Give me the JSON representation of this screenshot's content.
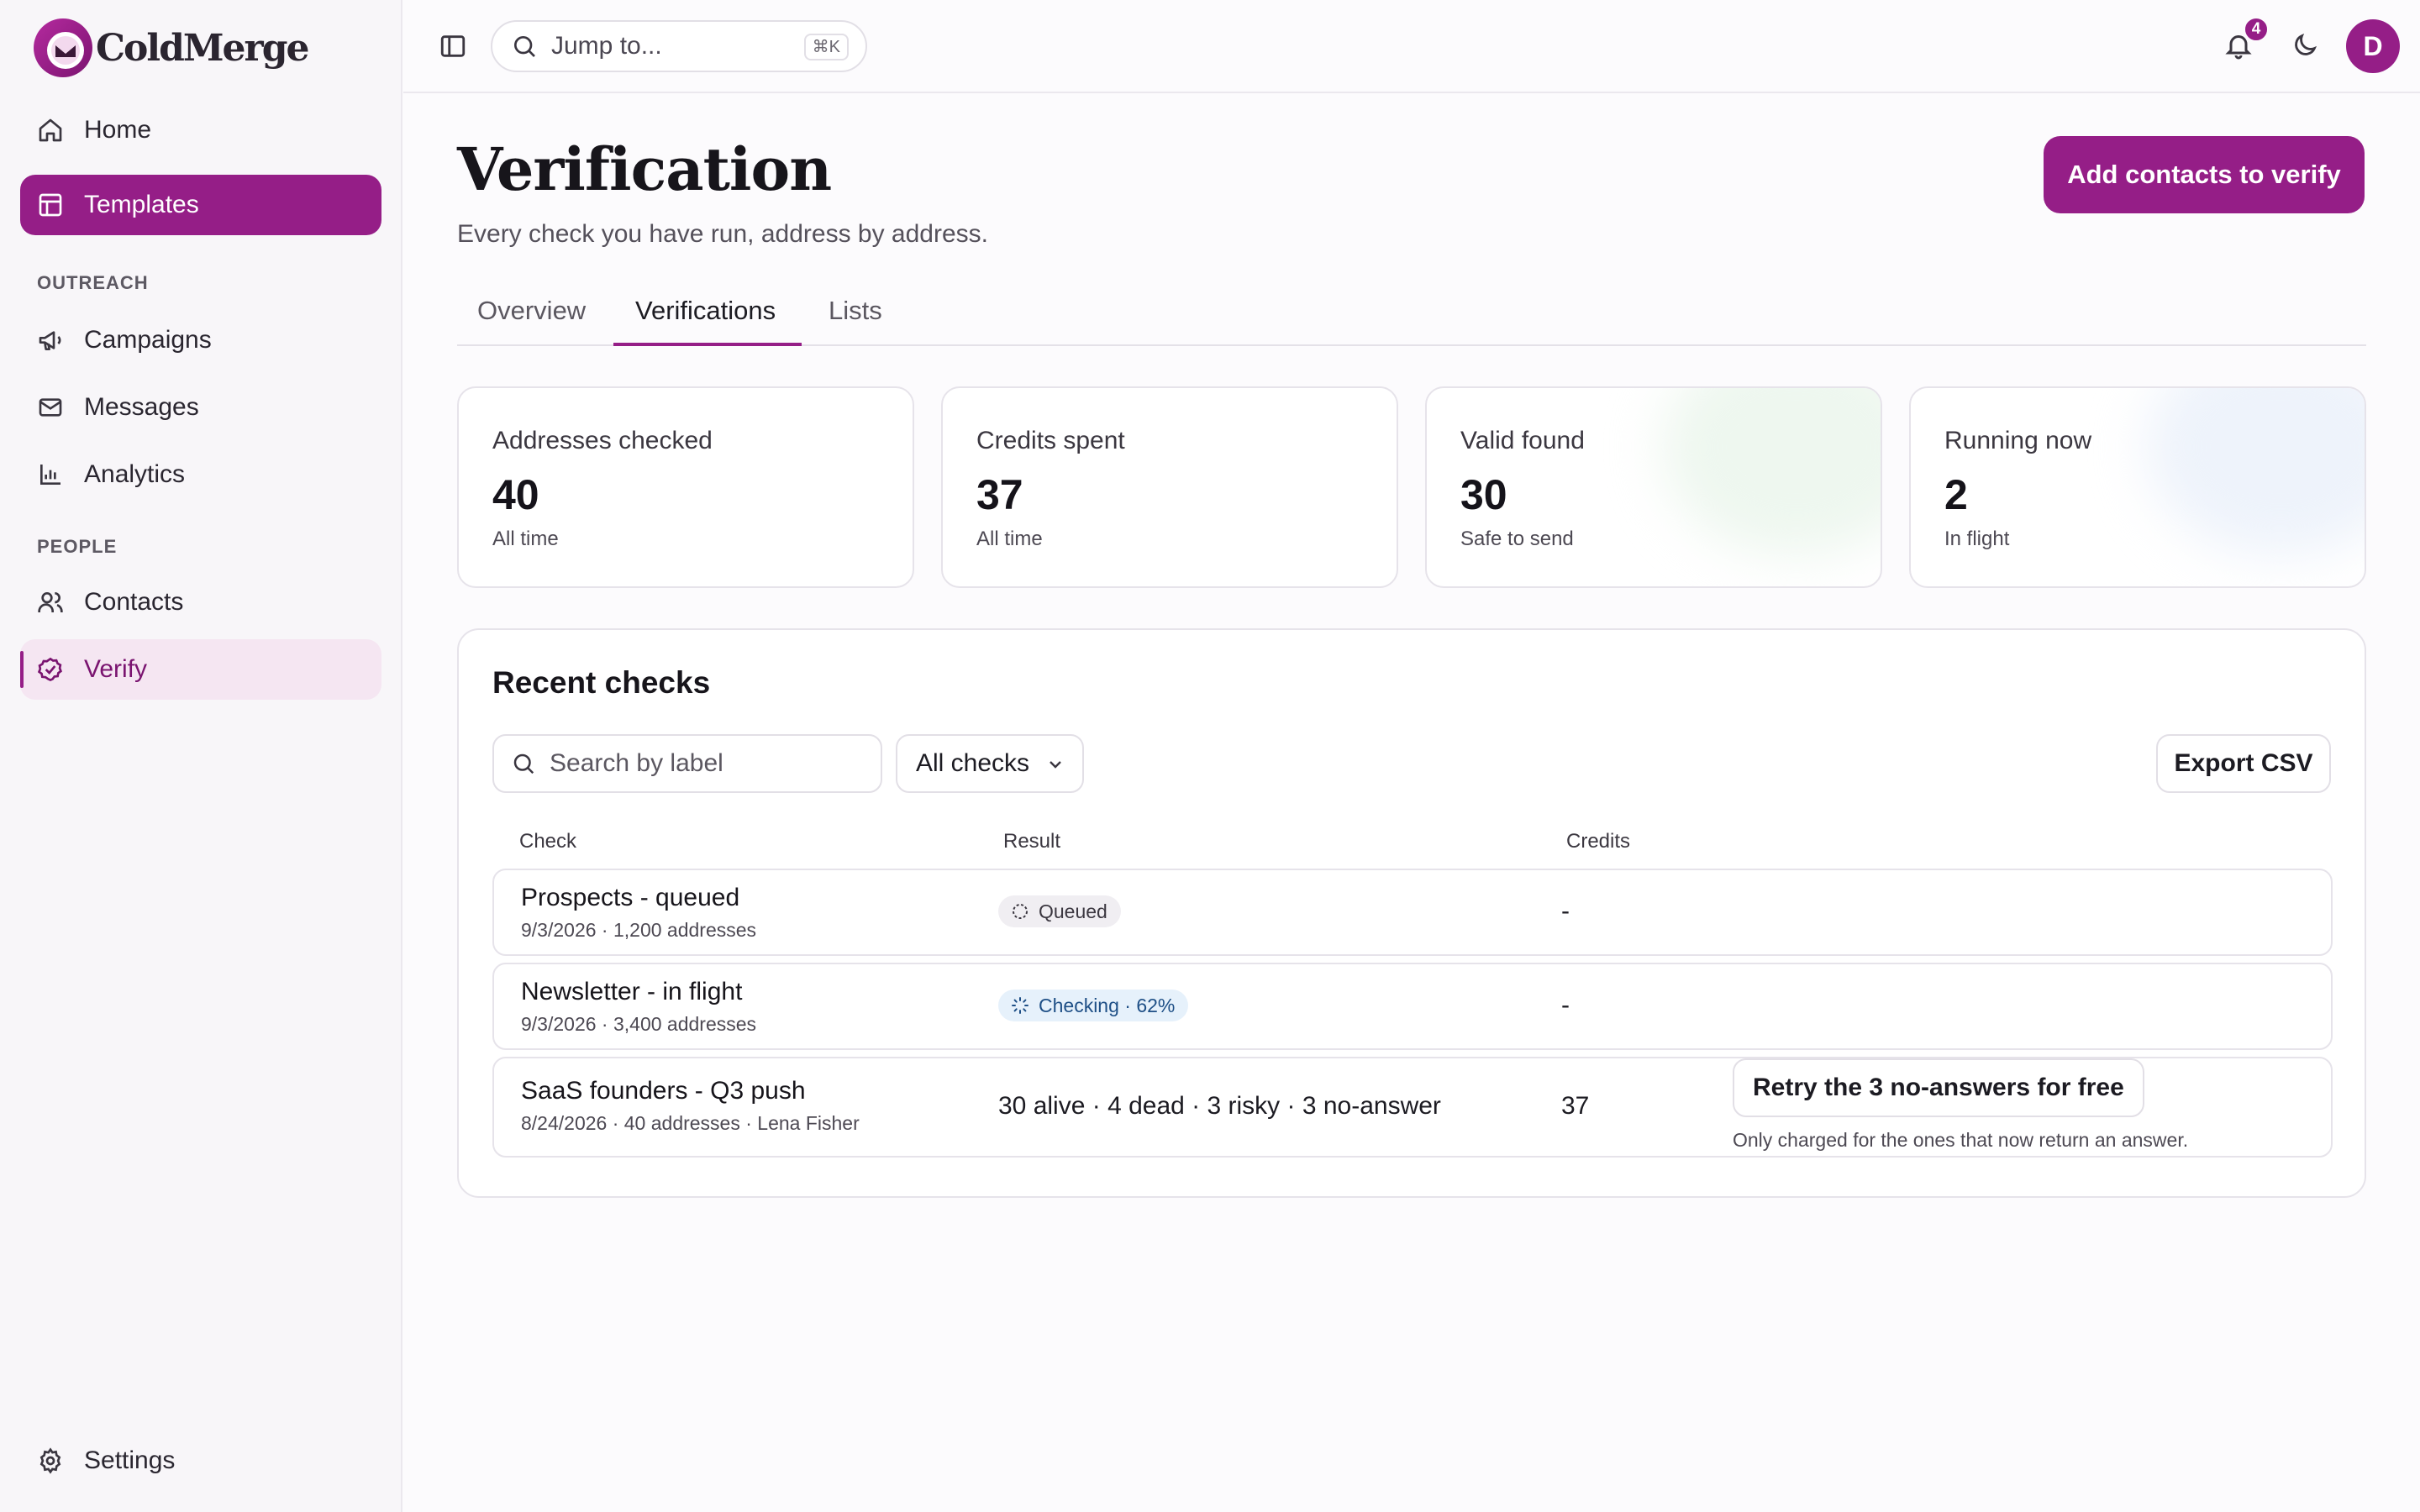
{
  "app": {
    "name": "ColdMerge"
  },
  "sidebar": {
    "top_items": [
      {
        "label": "Home",
        "icon": "home-icon"
      },
      {
        "label": "Templates",
        "icon": "layout-icon",
        "state": "highlighted"
      }
    ],
    "sections": [
      {
        "label": "OUTREACH",
        "items": [
          {
            "label": "Campaigns",
            "icon": "megaphone-icon"
          },
          {
            "label": "Messages",
            "icon": "mail-icon"
          },
          {
            "label": "Analytics",
            "icon": "bar-chart-icon"
          }
        ]
      },
      {
        "label": "PEOPLE",
        "items": [
          {
            "label": "Contacts",
            "icon": "users-icon"
          },
          {
            "label": "Verify",
            "icon": "check-circle-icon",
            "state": "active"
          }
        ]
      }
    ],
    "footer_item": {
      "label": "Settings",
      "icon": "gear-icon"
    }
  },
  "topbar": {
    "search_label": "Jump to...",
    "shortcut": "⌘K",
    "notification_count": "4",
    "avatar_initial": "D"
  },
  "page": {
    "title": "Verification",
    "subtitle": "Every check you have run, address by address.",
    "primary_action": "Add contacts to verify",
    "tabs": [
      "Overview",
      "Verifications",
      "Lists"
    ],
    "active_tab": "Verifications"
  },
  "stats": [
    {
      "label": "Addresses checked",
      "value": "40",
      "note": "All time"
    },
    {
      "label": "Credits spent",
      "value": "37",
      "note": "All time"
    },
    {
      "label": "Valid found",
      "value": "30",
      "note": "Safe to send"
    },
    {
      "label": "Running now",
      "value": "2",
      "note": "In flight"
    }
  ],
  "recent": {
    "title": "Recent checks",
    "search_placeholder": "Search by label",
    "filter_value": "All checks",
    "export_label": "Export CSV",
    "columns": [
      "Check",
      "Result",
      "Credits"
    ],
    "rows": [
      {
        "title": "Prospects - queued",
        "meta": "9/3/2026 · 1,200 addresses",
        "result": "Queued",
        "result_type": "queued",
        "credits": "-"
      },
      {
        "title": "Newsletter - in flight",
        "meta": "9/3/2026 · 3,400 addresses",
        "result": "Checking · 62%",
        "result_type": "checking",
        "progress_percent": 62,
        "credits": "-"
      },
      {
        "title": "SaaS founders - Q3 push",
        "meta": "8/24/2026 · 40 addresses · Lena Fisher",
        "result": "30 alive · 4 dead · 3 risky · 3 no-answer",
        "result_type": "done",
        "credits": "37",
        "action": {
          "label": "Retry the 3 no-answers for free",
          "note": "Only charged for the ones that now return an answer."
        }
      }
    ]
  },
  "colors": {
    "brand": "#951e87",
    "brand_soft": "#f5e6f2",
    "checking": "#1e4f86"
  }
}
